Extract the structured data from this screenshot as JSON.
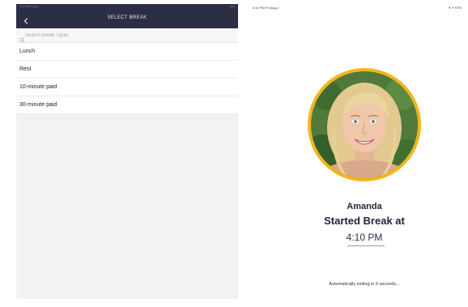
{
  "left": {
    "statusbar": {
      "left": "4:10 PM  Fri Aug 2",
      "right": "94%"
    },
    "header": {
      "title": "SELECT BREAK"
    },
    "search": {
      "placeholder": "Search Break Types"
    },
    "break_types": [
      "Lunch",
      "Rest",
      "10-minute paid",
      "30-minute paid"
    ]
  },
  "right": {
    "statusbar": {
      "time": "4:10 PM  Fri Aug 2",
      "icons": "▾ ↗ 97%"
    },
    "person": {
      "name": "Amanda"
    },
    "status": {
      "title": "Started Break at",
      "time": "4:10 PM"
    },
    "footer": {
      "exit_message": "Automatically exiting in 0 seconds..."
    },
    "colors": {
      "header_bg": "#2b2f44",
      "avatar_ring": "#f2b51d",
      "text_dark": "#1e2237"
    }
  }
}
